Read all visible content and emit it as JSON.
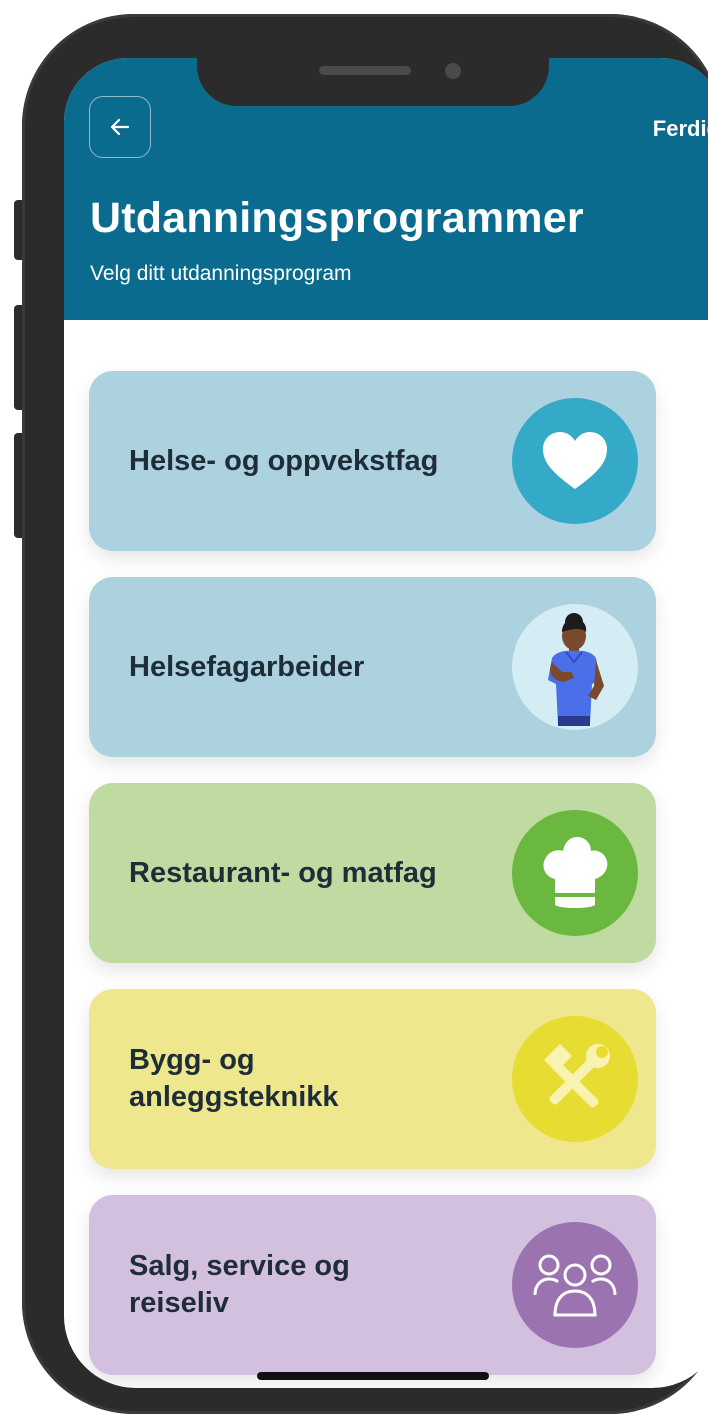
{
  "header": {
    "done_label": "Ferdig",
    "title": "Utdanningsprogrammer",
    "subtitle": "Velg ditt utdanningsprogram"
  },
  "programs": [
    {
      "label": "Helse- og oppvekstfag",
      "icon": "heart-icon",
      "bg": "#acd1df",
      "icon_bg": "#34a9c8"
    },
    {
      "label": "Helsefagarbeider",
      "icon": "health-worker-avatar",
      "bg": "#acd1df",
      "icon_bg": "#d4ecf3"
    },
    {
      "label": "Restaurant- og matfag",
      "icon": "chef-hat-icon",
      "bg": "#bfdba2",
      "icon_bg": "#6ab840"
    },
    {
      "label": "Bygg- og anleggsteknikk",
      "icon": "tools-icon",
      "bg": "#eee78e",
      "icon_bg": "#e7dc32"
    },
    {
      "label": "Salg, service og reiseliv",
      "icon": "people-icon",
      "bg": "#d2c0de",
      "icon_bg": "#9c73b1"
    }
  ]
}
